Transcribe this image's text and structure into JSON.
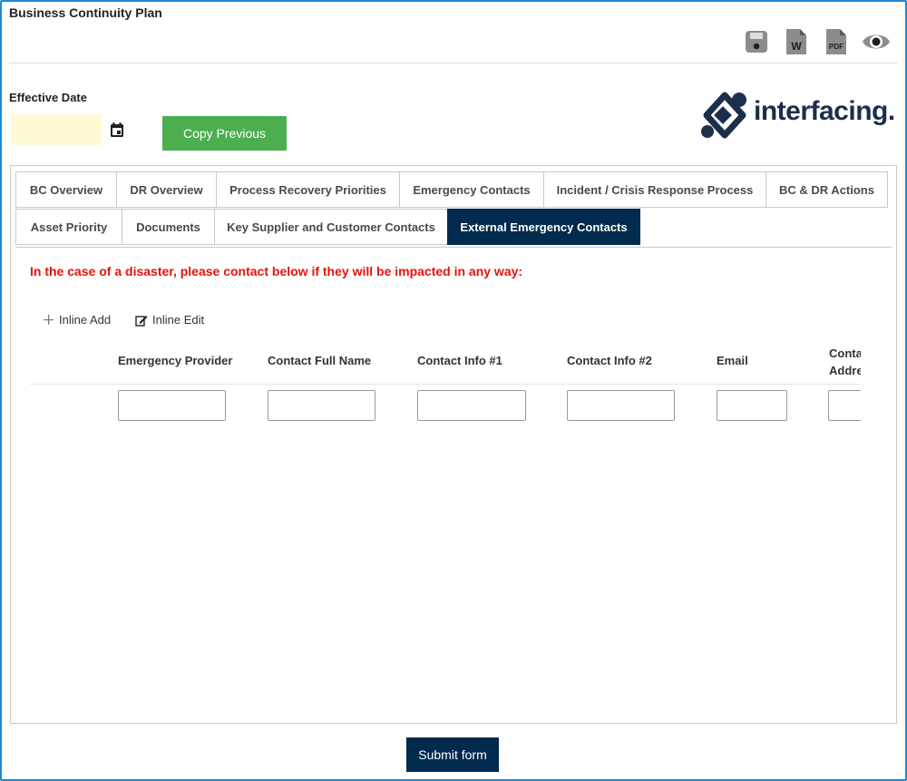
{
  "page": {
    "title": "Business Continuity Plan"
  },
  "toolbar": {
    "save_icon": "save-icon",
    "word_icon": "word-export-icon",
    "word_letter": "W",
    "pdf_icon": "pdf-export-icon",
    "pdf_letter": "PDF",
    "preview_icon": "eye-icon"
  },
  "effective_date": {
    "label": "Effective Date",
    "value": "",
    "calendar_icon": "calendar-icon"
  },
  "copy_previous": {
    "label": "Copy Previous"
  },
  "logo": {
    "text": "interfacing."
  },
  "tabs": {
    "row1": [
      {
        "label": "BC Overview"
      },
      {
        "label": "DR Overview"
      },
      {
        "label": "Process Recovery Priorities"
      },
      {
        "label": "Emergency Contacts"
      },
      {
        "label": "Incident / Crisis Response Process"
      },
      {
        "label": "BC & DR Actions"
      }
    ],
    "row2": [
      {
        "label": "Asset Priority"
      },
      {
        "label": "Documents"
      },
      {
        "label": "Key Supplier and Customer Contacts"
      },
      {
        "label": "External Emergency Contacts",
        "active": true
      }
    ]
  },
  "notice": {
    "text": "In the case of a disaster, please contact below if they will be impacted in any way:",
    "color": "#e8110a"
  },
  "grid": {
    "tools": {
      "inline_add": "Inline Add",
      "inline_add_icon": "plus-icon",
      "inline_edit": "Inline Edit",
      "inline_edit_icon": "edit-icon"
    },
    "columns": [
      {
        "label": "Emergency Provider"
      },
      {
        "label": "Contact Full Name"
      },
      {
        "label": "Contact Info #1"
      },
      {
        "label": "Contact Info #2"
      },
      {
        "label": "Email"
      },
      {
        "label": "Contact Address",
        "line1": "Conta",
        "line2": "Addre"
      }
    ],
    "row": [
      "",
      "",
      "",
      "",
      "",
      ""
    ]
  },
  "submit": {
    "label": "Submit form"
  },
  "colors": {
    "accent_navy": "#002a4e",
    "copy_green": "#4cae4f",
    "date_bg": "#fffbd6",
    "frame_blue": "#1b8ad6"
  }
}
